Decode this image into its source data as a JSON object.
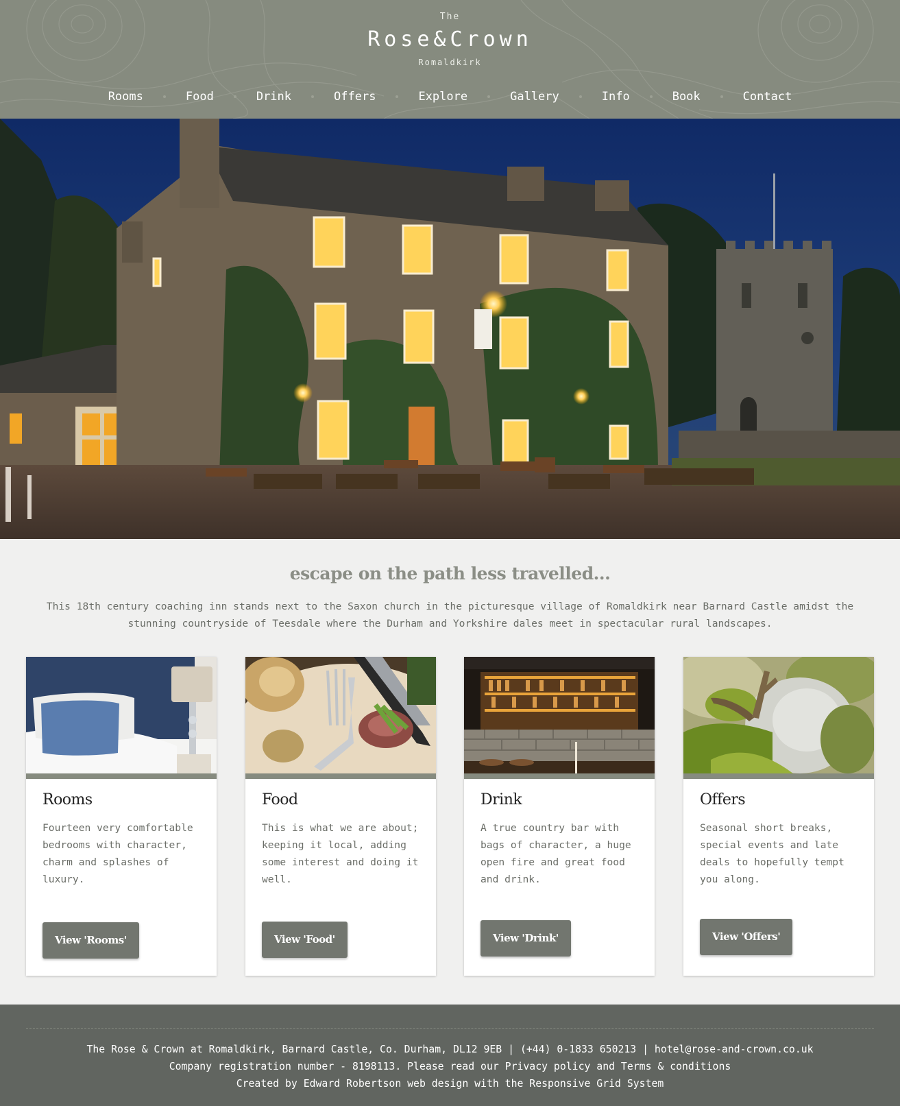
{
  "header": {
    "logo_the": "The",
    "logo_main": "Rose&Crown",
    "logo_sub": "Romaldkirk",
    "background": "#868b7f"
  },
  "nav": {
    "items": [
      {
        "label": "Rooms"
      },
      {
        "label": "Food"
      },
      {
        "label": "Drink"
      },
      {
        "label": "Offers"
      },
      {
        "label": "Explore"
      },
      {
        "label": "Gallery"
      },
      {
        "label": "Info"
      },
      {
        "label": "Book"
      },
      {
        "label": "Contact"
      }
    ]
  },
  "hero": {
    "image": "inn-at-dusk-photo"
  },
  "intro": {
    "tagline": "escape on the path less travelled...",
    "text": "This 18th century coaching inn stands next to the Saxon church in the picturesque village of Romaldkirk near Barnard Castle amidst the stunning countryside of Teesdale where the Durham and Yorkshire dales meet in spectacular rural landscapes."
  },
  "cards": [
    {
      "title": "Rooms",
      "text": "Fourteen very comfortable bedrooms with character, charm and splashes of luxury.",
      "button": "View 'Rooms'",
      "image": "bedroom-photo"
    },
    {
      "title": "Food",
      "text": "This is what we are about; keeping it local, adding some interest and doing it well.",
      "button": "View 'Food'",
      "image": "food-plate-photo"
    },
    {
      "title": "Drink",
      "text": "A true country bar with bags of character, a huge open fire and great food and drink.",
      "button": "View 'Drink'",
      "image": "bar-photo"
    },
    {
      "title": "Offers",
      "text": "Seasonal short breaks, special events and late deals to hopefully tempt you along.",
      "button": "View 'Offers'",
      "image": "antler-moss-photo"
    }
  ],
  "footer": {
    "line1": "The Rose & Crown at Romaldkirk, Barnard Castle, Co. Durham, DL12 9EB | (+44) 0-1833 650213 | hotel@rose-and-crown.co.uk",
    "line2": "Company registration number - 8198113. Please read our Privacy policy and Terms & conditions",
    "line3": "Created by Edward Robertson web design with the Responsive Grid System",
    "background": "#616560"
  },
  "colors": {
    "accent": "#868b7f",
    "button": "#72766f",
    "page_background": "#f0f0ef"
  }
}
